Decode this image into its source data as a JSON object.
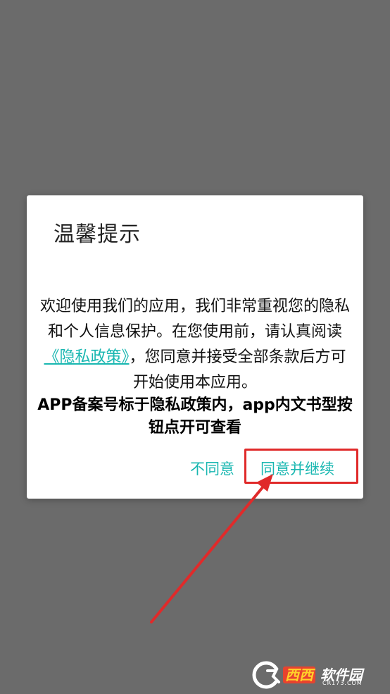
{
  "dialog": {
    "title": "温馨提示",
    "body_line1": "欢迎使用我们的应用，我们非常重视您的隐私",
    "body_line2": "和个人信息保护。在您使用前，请认真阅读",
    "policy_link": "《隐私政策》",
    "body_line3_after": "，您同意并接受全部条款后方可",
    "body_line4": "开始使用本应用。",
    "notice_line1": "APP备案号标于隐私政策内，app内文书型按",
    "notice_line2": "钮点开可查看",
    "disagree_label": "不同意",
    "agree_label": "同意并继续"
  },
  "colors": {
    "overlay": "#6b6b6b",
    "accent": "#19b7b1",
    "highlight": "#e02a2a"
  },
  "watermark": {
    "brand": "西西",
    "suffix": "软件园",
    "site": "CR173.COM"
  }
}
